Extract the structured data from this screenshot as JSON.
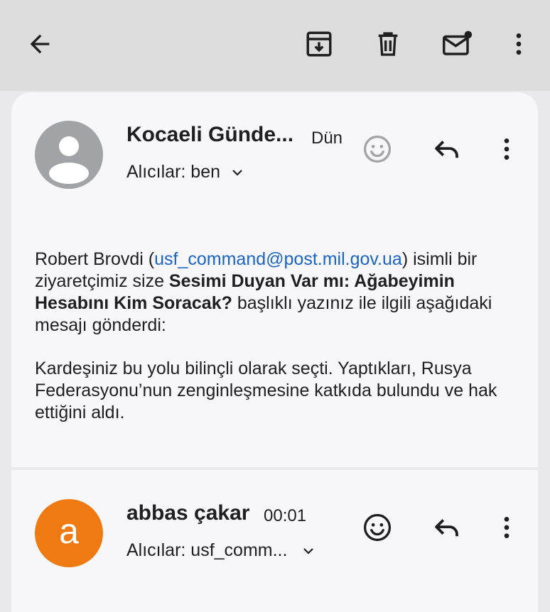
{
  "toolbar": {
    "back_icon": "arrow-left-icon",
    "archive_icon": "archive-icon",
    "delete_icon": "trash-icon",
    "mark_unread_icon": "mail-unread-icon",
    "more_icon": "more-vert-icon"
  },
  "messages": [
    {
      "sender": "Kocaeli Günde...",
      "time": "Dün",
      "recipients": "Alıcılar: ben",
      "avatar_type": "person-placeholder",
      "avatar_color": "#a1a3a7",
      "body": {
        "p1_name": "Robert Brovdi (",
        "p1_email": "usf_command@post.mil.gov.ua",
        "p1_after_email": ") isimli bir ziyaretçimiz size ",
        "p1_title": "Sesimi Duyan Var mı: Ağabeyimin Hesabını Kim Soracak?",
        "p1_end": " başlıklı yazınız ile ilgili aşağıdaki mesajı gönderdi:",
        "p2": "Kardeşiniz bu yolu bilinçli olarak seçti. Yaptıkları, Rusya Federasyonu’nun zenginleşmesine katkıda bulundu ve hak ettiğini aldı."
      }
    },
    {
      "sender": "abbas çakar",
      "time": "00:01",
      "recipients": "Alıcılar: usf_comm...",
      "avatar_letter": "a",
      "avatar_color": "#f07a12"
    }
  ],
  "colors": {
    "link": "#1a64c6",
    "appbar_bg": "#dcdcdc",
    "card_bg": "#f7f7fa",
    "page_bg": "#e9e8eb"
  }
}
